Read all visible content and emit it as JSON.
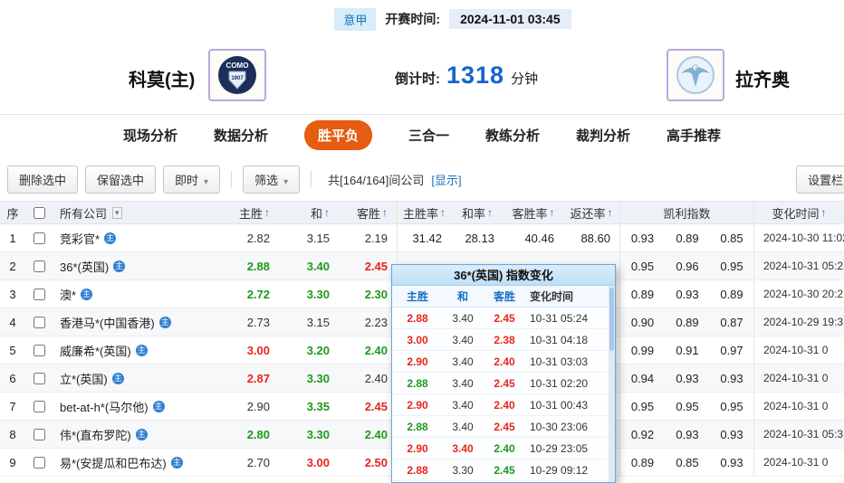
{
  "header": {
    "league": "意甲",
    "start_label": "开赛时间:",
    "start_time": "2024-11-01 03:45",
    "home_team": "科莫(主)",
    "away_team": "拉齐奥",
    "countdown_label": "倒计时:",
    "countdown_value": "1318",
    "countdown_unit": "分钟"
  },
  "tabs": [
    {
      "label": "现场分析",
      "active": false
    },
    {
      "label": "数据分析",
      "active": false
    },
    {
      "label": "胜平负",
      "active": true
    },
    {
      "label": "三合一",
      "active": false
    },
    {
      "label": "教练分析",
      "active": false
    },
    {
      "label": "裁判分析",
      "active": false
    },
    {
      "label": "高手推荐",
      "active": false
    }
  ],
  "toolbar": {
    "delete_selected": "删除选中",
    "keep_selected": "保留选中",
    "instant": "即时",
    "filter": "筛选",
    "company_count": "共[164/164]间公司",
    "show_link": "[显示]",
    "settings": "设置栏"
  },
  "icons": {
    "sort_asc": "↑",
    "caret_down": "▾",
    "company_tag": "主"
  },
  "table": {
    "headers": {
      "index": "序",
      "company": "所有公司",
      "home": "主胜",
      "draw": "和",
      "away": "客胜",
      "home_rate": "主胜率",
      "draw_rate": "和率",
      "away_rate": "客胜率",
      "return_rate": "返还率",
      "kelly": "凯利指数",
      "change_time": "变化时间"
    },
    "rows": [
      {
        "num": "1",
        "company": "竞彩官*",
        "odds": [
          {
            "v": "2.82",
            "c": "k"
          },
          {
            "v": "3.15",
            "c": "k"
          },
          {
            "v": "2.19",
            "c": "k"
          }
        ],
        "rates": [
          "31.42",
          "28.13",
          "40.46",
          "88.60"
        ],
        "kelly": [
          "0.93",
          "0.89",
          "0.85"
        ],
        "time": "2024-10-30 11:02"
      },
      {
        "num": "2",
        "company": "36*(英国)",
        "odds": [
          {
            "v": "2.88",
            "c": "g"
          },
          {
            "v": "3.40",
            "c": "g"
          },
          {
            "v": "2.45",
            "c": "r"
          }
        ],
        "rates": [
          "",
          "",
          "",
          ""
        ],
        "kelly": [
          "0.95",
          "0.96",
          "0.95"
        ],
        "time": "2024-10-31 05:2"
      },
      {
        "num": "3",
        "company": "澳*",
        "odds": [
          {
            "v": "2.72",
            "c": "g"
          },
          {
            "v": "3.30",
            "c": "g"
          },
          {
            "v": "2.30",
            "c": "g"
          }
        ],
        "rates": [
          "",
          "",
          "",
          ""
        ],
        "kelly": [
          "0.89",
          "0.93",
          "0.89"
        ],
        "time": "2024-10-30 20:2"
      },
      {
        "num": "4",
        "company": "香港马*(中国香港)",
        "odds": [
          {
            "v": "2.73",
            "c": "k"
          },
          {
            "v": "3.15",
            "c": "k"
          },
          {
            "v": "2.23",
            "c": "k"
          }
        ],
        "rates": [
          "",
          "",
          "",
          ""
        ],
        "kelly": [
          "0.90",
          "0.89",
          "0.87"
        ],
        "time": "2024-10-29 19:3"
      },
      {
        "num": "5",
        "company": "威廉希*(英国)",
        "odds": [
          {
            "v": "3.00",
            "c": "r"
          },
          {
            "v": "3.20",
            "c": "g"
          },
          {
            "v": "2.40",
            "c": "g"
          }
        ],
        "rates": [
          "",
          "",
          "",
          ""
        ],
        "kelly": [
          "0.99",
          "0.91",
          "0.97"
        ],
        "time": "2024-10-31 0"
      },
      {
        "num": "6",
        "company": "立*(英国)",
        "odds": [
          {
            "v": "2.87",
            "c": "r"
          },
          {
            "v": "3.30",
            "c": "g"
          },
          {
            "v": "2.40",
            "c": "k"
          }
        ],
        "rates": [
          "",
          "",
          "",
          ""
        ],
        "kelly": [
          "0.94",
          "0.93",
          "0.93"
        ],
        "time": "2024-10-31 0"
      },
      {
        "num": "7",
        "company": "bet-at-h*(马尔他)",
        "odds": [
          {
            "v": "2.90",
            "c": "k"
          },
          {
            "v": "3.35",
            "c": "g"
          },
          {
            "v": "2.45",
            "c": "r"
          }
        ],
        "rates": [
          "",
          "",
          "",
          ""
        ],
        "kelly": [
          "0.95",
          "0.95",
          "0.95"
        ],
        "time": "2024-10-31 0"
      },
      {
        "num": "8",
        "company": "伟*(直布罗陀)",
        "odds": [
          {
            "v": "2.80",
            "c": "g"
          },
          {
            "v": "3.30",
            "c": "g"
          },
          {
            "v": "2.40",
            "c": "g"
          }
        ],
        "rates": [
          "",
          "",
          "",
          ""
        ],
        "kelly": [
          "0.92",
          "0.93",
          "0.93"
        ],
        "time": "2024-10-31 05:3"
      },
      {
        "num": "9",
        "company": "易*(安提瓜和巴布达)",
        "odds": [
          {
            "v": "2.70",
            "c": "k"
          },
          {
            "v": "3.00",
            "c": "r"
          },
          {
            "v": "2.50",
            "c": "r"
          }
        ],
        "rates": [
          "",
          "",
          "",
          ""
        ],
        "kelly": [
          "0.89",
          "0.85",
          "0.93"
        ],
        "time": "2024-10-31 0"
      }
    ]
  },
  "popup": {
    "title": "36*(英国) 指数变化",
    "headers": [
      "主胜",
      "和",
      "客胜",
      "变化时间"
    ],
    "rows": [
      {
        "odds": [
          {
            "v": "2.88",
            "c": "r"
          },
          {
            "v": "3.40",
            "c": "k"
          },
          {
            "v": "2.45",
            "c": "r"
          }
        ],
        "time": "10-31 05:24"
      },
      {
        "odds": [
          {
            "v": "3.00",
            "c": "r"
          },
          {
            "v": "3.40",
            "c": "k"
          },
          {
            "v": "2.38",
            "c": "r"
          }
        ],
        "time": "10-31 04:18"
      },
      {
        "odds": [
          {
            "v": "2.90",
            "c": "r"
          },
          {
            "v": "3.40",
            "c": "k"
          },
          {
            "v": "2.40",
            "c": "r"
          }
        ],
        "time": "10-31 03:03"
      },
      {
        "odds": [
          {
            "v": "2.88",
            "c": "g"
          },
          {
            "v": "3.40",
            "c": "k"
          },
          {
            "v": "2.45",
            "c": "r"
          }
        ],
        "time": "10-31 02:20"
      },
      {
        "odds": [
          {
            "v": "2.90",
            "c": "r"
          },
          {
            "v": "3.40",
            "c": "k"
          },
          {
            "v": "2.40",
            "c": "r"
          }
        ],
        "time": "10-31 00:43"
      },
      {
        "odds": [
          {
            "v": "2.88",
            "c": "g"
          },
          {
            "v": "3.40",
            "c": "k"
          },
          {
            "v": "2.45",
            "c": "r"
          }
        ],
        "time": "10-30 23:06"
      },
      {
        "odds": [
          {
            "v": "2.90",
            "c": "r"
          },
          {
            "v": "3.40",
            "c": "r"
          },
          {
            "v": "2.40",
            "c": "g"
          }
        ],
        "time": "10-29 23:05"
      },
      {
        "odds": [
          {
            "v": "2.88",
            "c": "r"
          },
          {
            "v": "3.30",
            "c": "k"
          },
          {
            "v": "2.45",
            "c": "g"
          }
        ],
        "time": "10-29 09:12"
      }
    ]
  },
  "colors": {
    "red": "#e8251c",
    "green": "#1d9a1d",
    "black": "#333333",
    "blue": "#1a6fc0",
    "accent_orange": "#e65c11"
  }
}
